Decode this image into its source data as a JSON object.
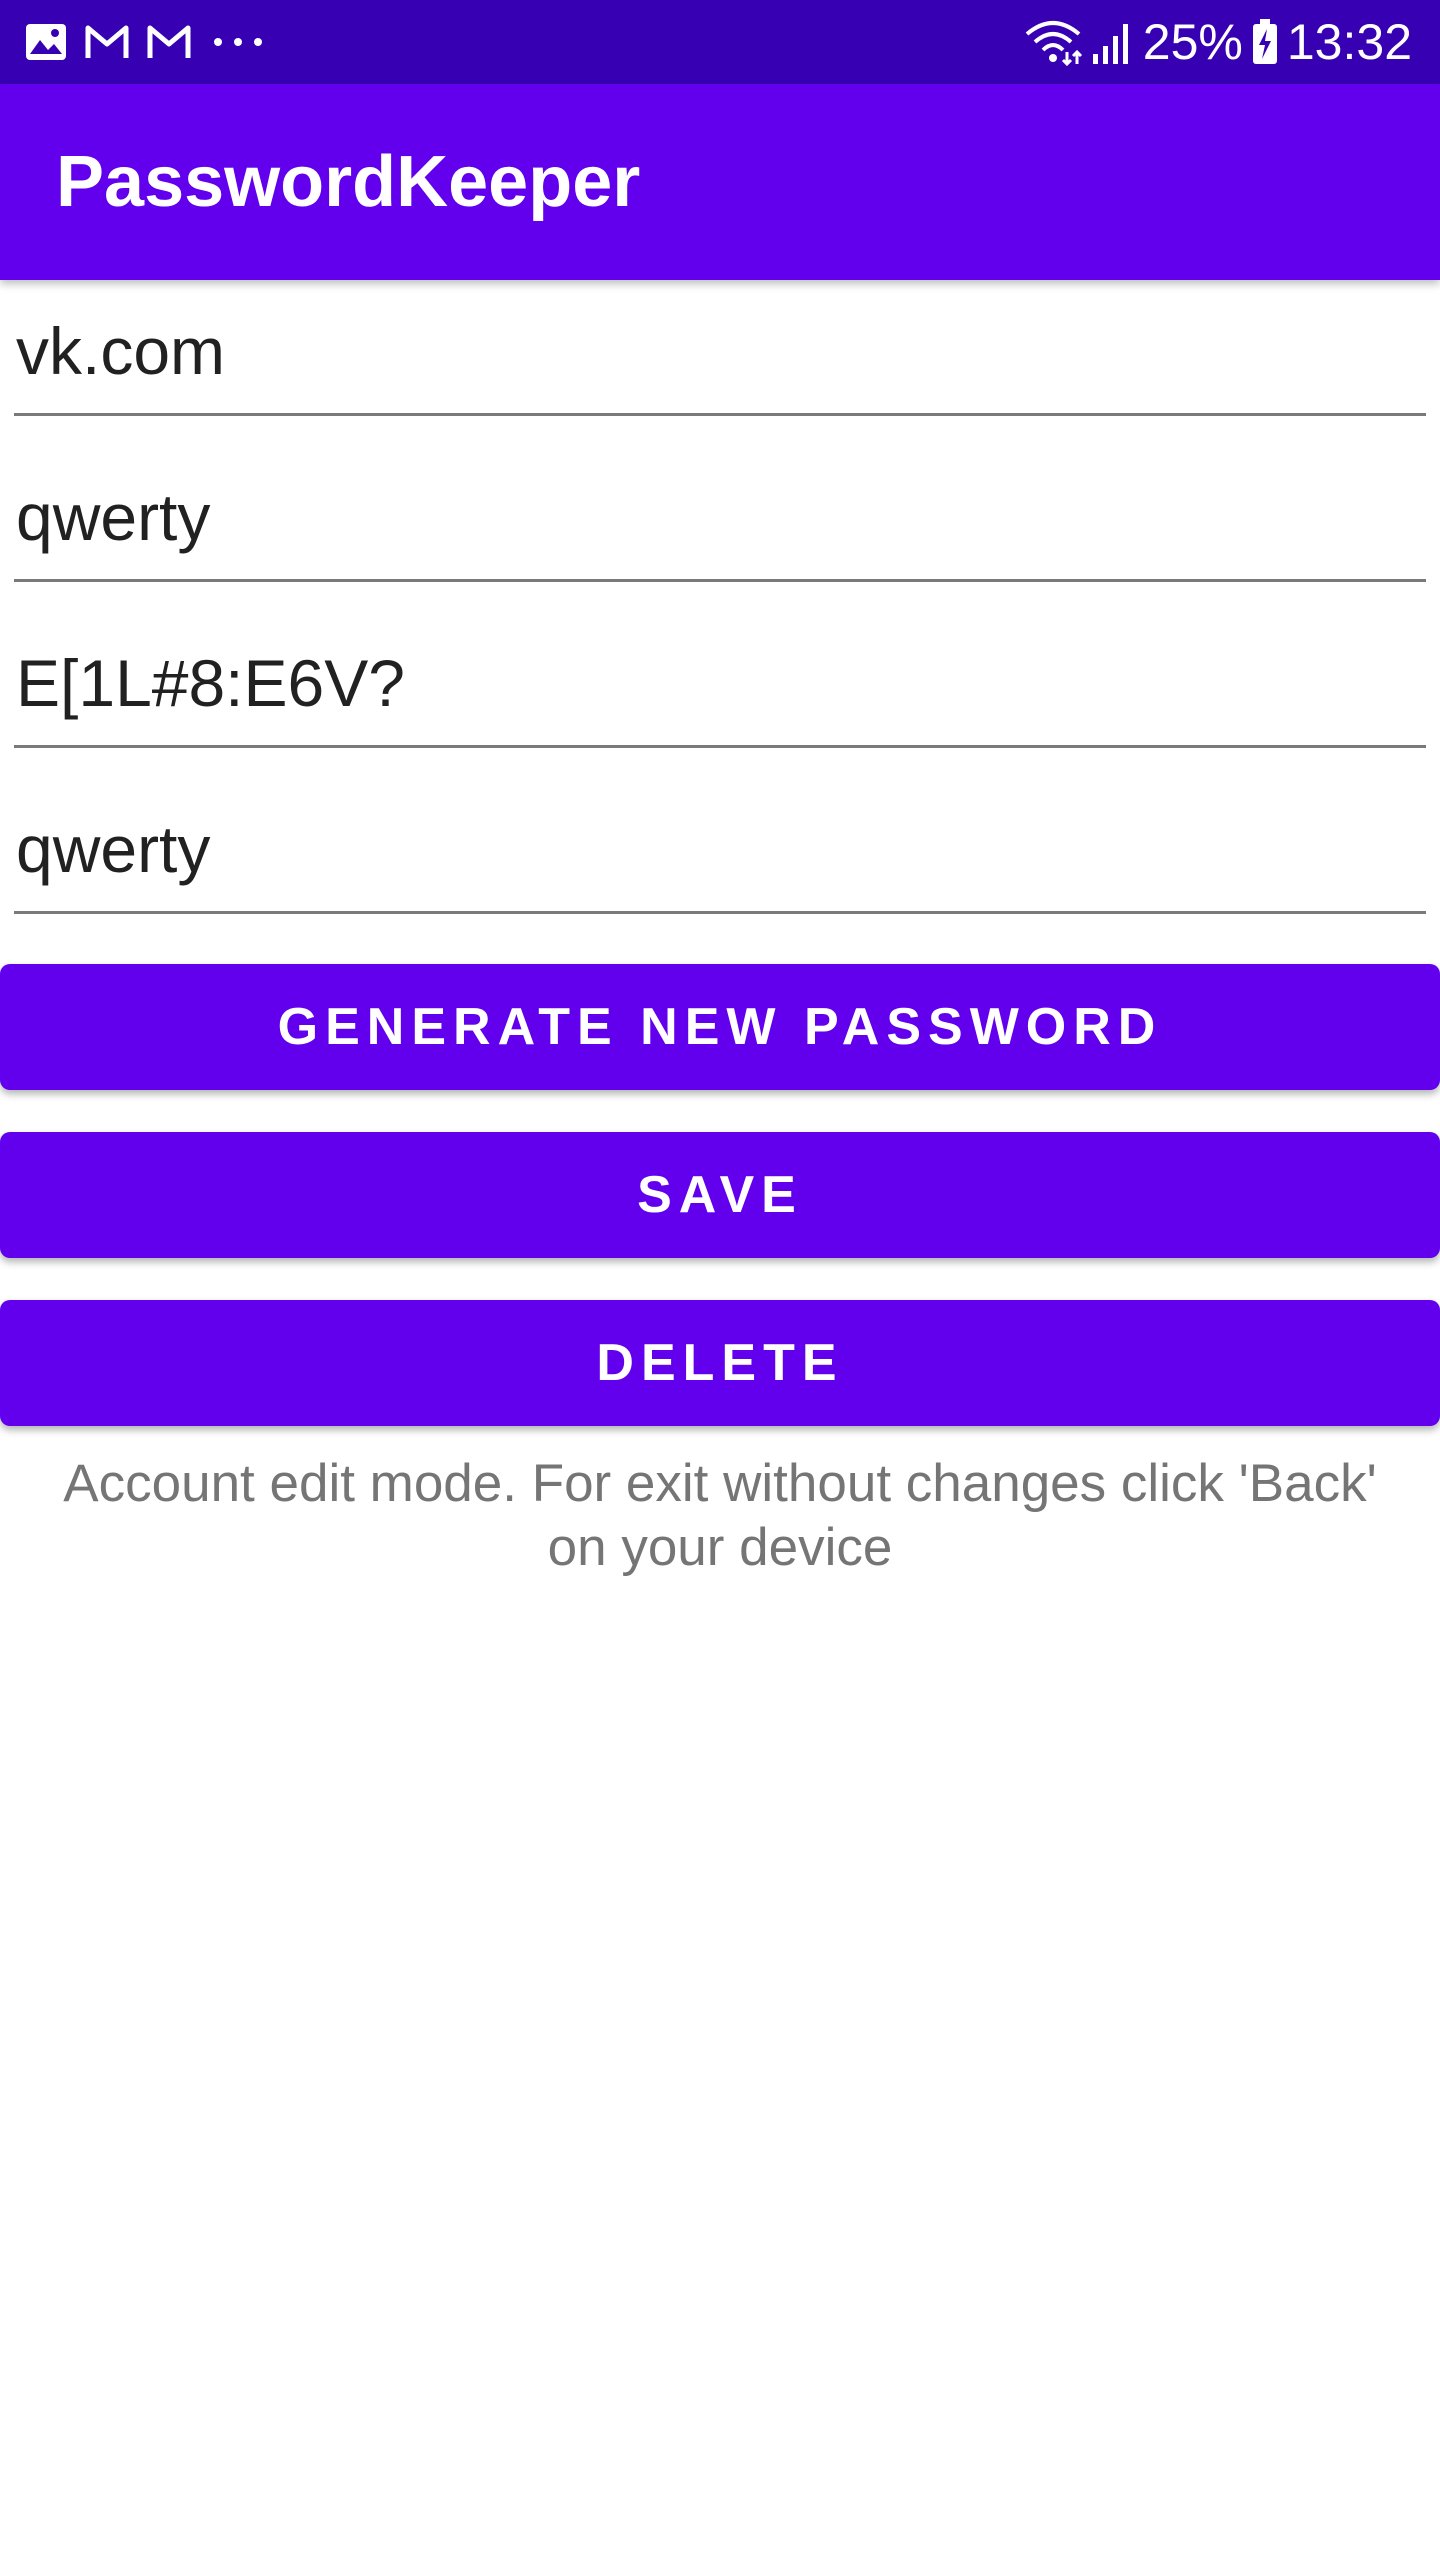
{
  "status_bar": {
    "left_icons": [
      "gallery-icon",
      "gmail-icon",
      "gmail-icon",
      "more-notifications-icon"
    ],
    "battery_percent": "25%",
    "time": "13:32",
    "right_icons": [
      "wifi-icon",
      "signal-icon",
      "battery-charging-icon"
    ]
  },
  "app_bar": {
    "title": "PasswordKeeper"
  },
  "form": {
    "site_value": "vk.com",
    "login_value": "qwerty",
    "password_value": "E[1L#8:E6V?",
    "note_value": "qwerty"
  },
  "buttons": {
    "generate_label": "GENERATE NEW PASSWORD",
    "save_label": "SAVE",
    "delete_label": "DELETE"
  },
  "hint_text": "Account edit mode. For exit without changes click 'Back' on your device",
  "colors": {
    "status_bar": "#3700b3",
    "primary": "#6200ee",
    "hint_text": "#757575"
  }
}
